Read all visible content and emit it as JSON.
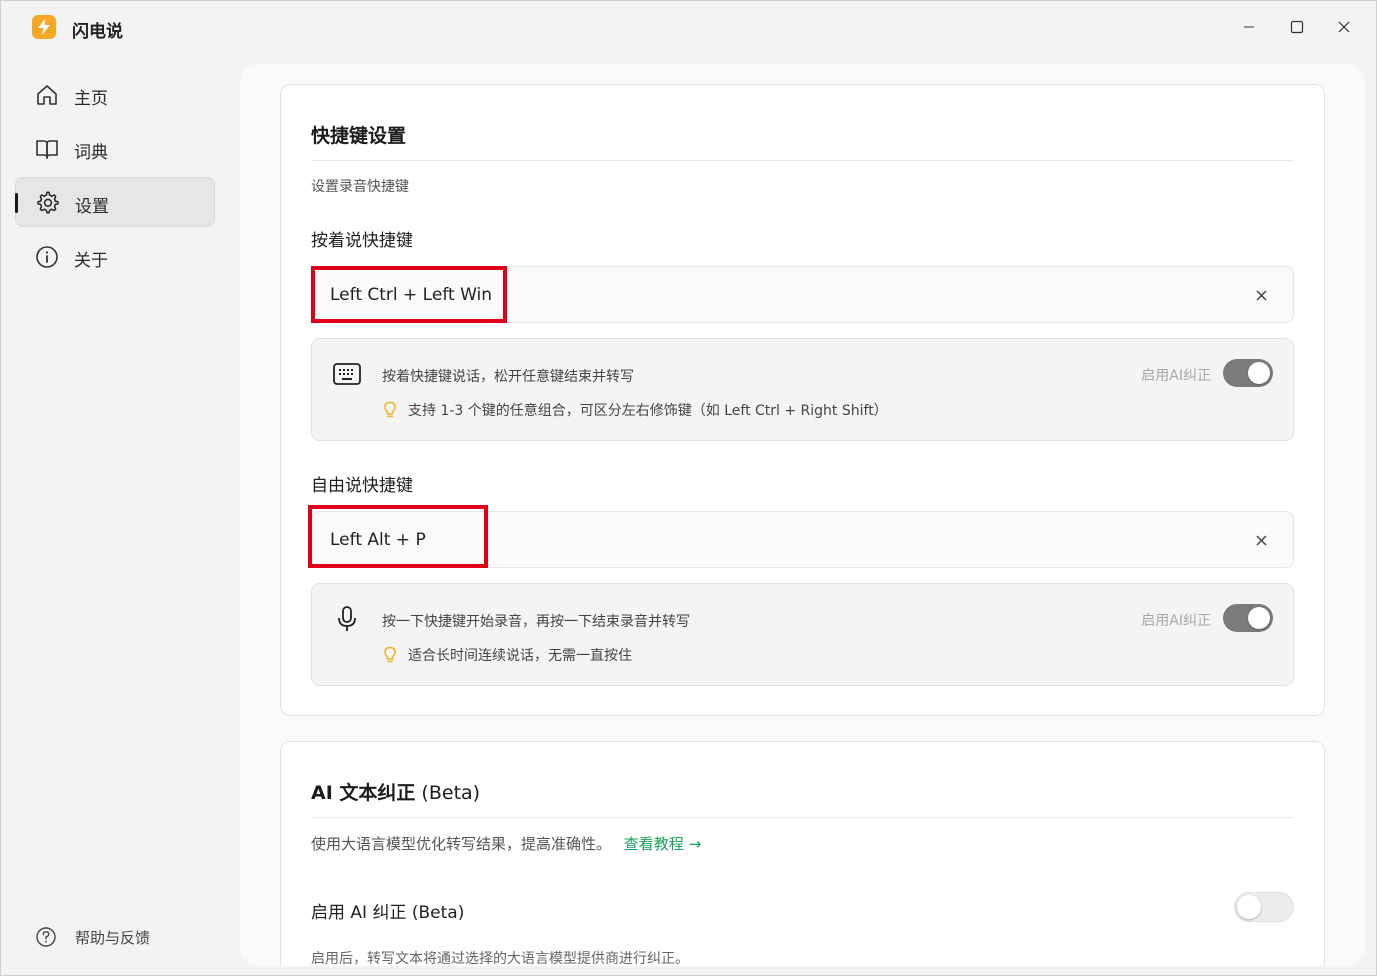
{
  "app": {
    "title": "闪电说"
  },
  "sidebar": {
    "items": [
      {
        "label": "主页",
        "icon": "home-icon"
      },
      {
        "label": "词典",
        "icon": "book-icon"
      },
      {
        "label": "设置",
        "icon": "gear-icon",
        "active": true
      },
      {
        "label": "关于",
        "icon": "info-icon"
      }
    ],
    "help_label": "帮助与反馈"
  },
  "shortcuts": {
    "title": "快捷键设置",
    "subtitle": "设置录音快捷键",
    "hold": {
      "label": "按着说快捷键",
      "value": "Left Ctrl + Left Win",
      "desc": "按着快捷键说话，松开任意键结束并转写",
      "tip": "支持 1-3 个键的任意组合，可区分左右修饰键（如 Left Ctrl + Right Shift）",
      "ai_label": "启用AI纠正",
      "ai_enabled": true
    },
    "free": {
      "label": "自由说快捷键",
      "value": "Left Alt + P",
      "desc": "按一下快捷键开始录音，再按一下结束录音并转写",
      "tip": "适合长时间连续说话，无需一直按住",
      "ai_label": "启用AI纠正",
      "ai_enabled": true
    }
  },
  "ai_correction": {
    "title_prefix": "AI 文本纠正",
    "title_suffix": " (Beta)",
    "desc": "使用大语言模型优化转写结果，提高准确性。",
    "link": "查看教程 →",
    "toggle_label": "启用 AI 纠正 (Beta)",
    "toggle_enabled": false,
    "toggle_desc": "启用后，转写文本将通过选择的大语言模型提供商进行纠正。"
  },
  "colors": {
    "accent_green": "#19a25c",
    "highlight_red": "#e0001a",
    "logo_orange": "#f7a823"
  }
}
